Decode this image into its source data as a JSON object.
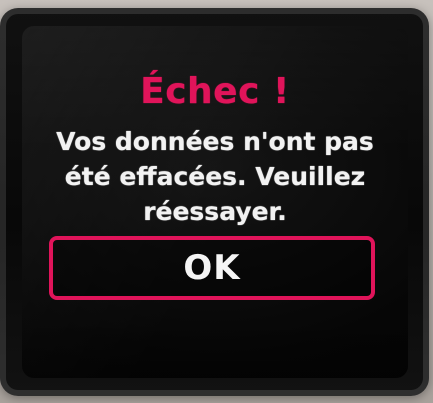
{
  "dialog": {
    "title": "Échec !",
    "message": "Vos données n'ont pas été effacées. Veuillez réessayer.",
    "ok_label": "OK"
  },
  "colors": {
    "accent": "#e0145a",
    "text": "#f2f2f2",
    "background": "#060606"
  }
}
